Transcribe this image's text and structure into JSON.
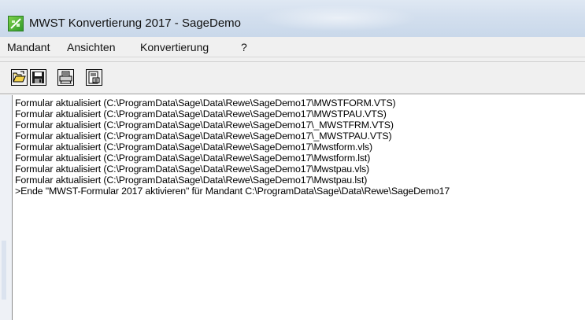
{
  "window": {
    "title": "MWST Konvertierung 2017 - SageDemo",
    "app_icon": "sage-app-icon"
  },
  "menu": {
    "items": [
      "Mandant",
      "Ansichten",
      "Konvertierung",
      "?"
    ]
  },
  "toolbar": {
    "buttons": [
      {
        "icon": "open-folder-icon"
      },
      {
        "icon": "save-disk-icon"
      },
      {
        "icon": "printer-icon"
      },
      {
        "icon": "properties-icon"
      }
    ]
  },
  "log": {
    "lines": [
      "Formular aktualisiert (C:\\ProgramData\\Sage\\Data\\Rewe\\SageDemo17\\MWSTFORM.VTS)",
      "Formular aktualisiert (C:\\ProgramData\\Sage\\Data\\Rewe\\SageDemo17\\MWSTPAU.VTS)",
      "Formular aktualisiert (C:\\ProgramData\\Sage\\Data\\Rewe\\SageDemo17\\_MWSTFRM.VTS)",
      "Formular aktualisiert (C:\\ProgramData\\Sage\\Data\\Rewe\\SageDemo17\\_MWSTPAU.VTS)",
      "Formular aktualisiert (C:\\ProgramData\\Sage\\Data\\Rewe\\SageDemo17\\Mwstform.vls)",
      "Formular aktualisiert (C:\\ProgramData\\Sage\\Data\\Rewe\\SageDemo17\\Mwstform.lst)",
      "Formular aktualisiert (C:\\ProgramData\\Sage\\Data\\Rewe\\SageDemo17\\Mwstpau.vls)",
      "Formular aktualisiert (C:\\ProgramData\\Sage\\Data\\Rewe\\SageDemo17\\Mwstpau.lst)",
      ">Ende \"MWST-Formular 2017 aktivieren\" für Mandant C:\\ProgramData\\Sage\\Data\\Rewe\\SageDemo17"
    ]
  }
}
